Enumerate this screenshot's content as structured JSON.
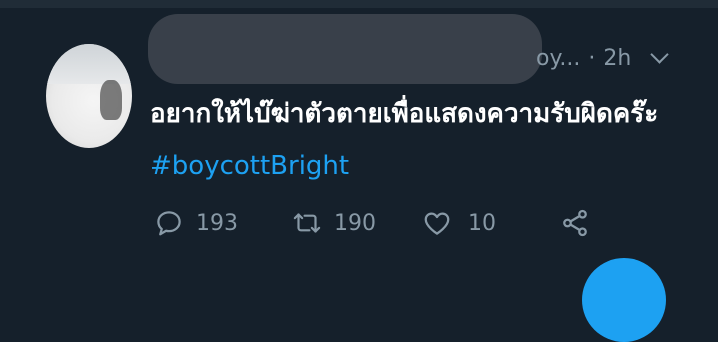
{
  "tweet": {
    "handle_fragment": "oy...",
    "separator": "·",
    "time": "2h",
    "text_main": "อยากให้ไบ๊ฆ่าตัวตายเพื่อแสดงความรับผิดคร๊ะ",
    "hashtag": "#boycottBright"
  },
  "actions": {
    "reply_count": "193",
    "retweet_count": "190",
    "like_count": "10"
  },
  "icons": {
    "reply": "reply-icon",
    "retweet": "retweet-icon",
    "like": "heart-icon",
    "share": "share-icon",
    "menu": "chevron-down-icon"
  },
  "colors": {
    "background": "#15202b",
    "text": "#ffffff",
    "muted": "#8899a6",
    "accent": "#1da1f2"
  }
}
